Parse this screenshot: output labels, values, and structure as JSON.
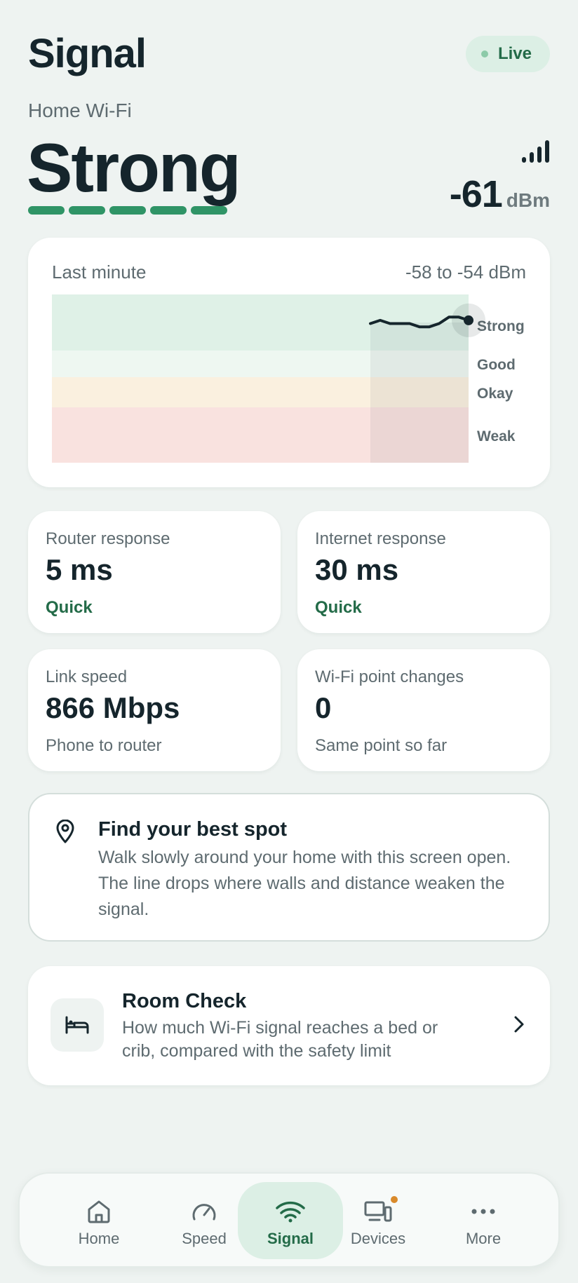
{
  "header": {
    "title": "Signal",
    "live_label": "Live"
  },
  "signal": {
    "network": "Home Wi-Fi",
    "strength": "Strong",
    "level_bars": 5,
    "dbm_value": "-61",
    "dbm_unit": "dBm"
  },
  "chart": {
    "label": "Last minute",
    "range": "-58 to -54 dBm",
    "bands": [
      {
        "name": "Strong",
        "color": "#dff1e7"
      },
      {
        "name": "Good",
        "color": "#eef7f1"
      },
      {
        "name": "Okay",
        "color": "#faf0df"
      },
      {
        "name": "Weak",
        "color": "#f9e2df"
      }
    ]
  },
  "chart_data": {
    "type": "line",
    "x": [
      0,
      1,
      2,
      3,
      4,
      5,
      6,
      7,
      8,
      9,
      10
    ],
    "y": [
      -57,
      -56,
      -57,
      -57,
      -57,
      -58,
      -58,
      -57,
      -55,
      -55,
      -56
    ],
    "ylim": [
      -100,
      -48
    ]
  },
  "metrics": [
    {
      "label": "Router response",
      "value": "5 ms",
      "sub": "Quick",
      "good": true
    },
    {
      "label": "Internet response",
      "value": "30 ms",
      "sub": "Quick",
      "good": true
    },
    {
      "label": "Link speed",
      "value": "866 Mbps",
      "sub": "Phone to router",
      "good": false
    },
    {
      "label": "Wi-Fi point changes",
      "value": "0",
      "sub": "Same point so far",
      "good": false
    }
  ],
  "tip": {
    "title": "Find your best spot",
    "text": "Walk slowly around your home with this screen open. The line drops where walls and distance weaken the signal."
  },
  "room_check": {
    "title": "Room Check",
    "text": "How much Wi-Fi signal reaches a bed or crib, compared with the safety limit"
  },
  "nav": {
    "items": [
      {
        "label": "Home",
        "icon": "home-icon"
      },
      {
        "label": "Speed",
        "icon": "speedometer-icon"
      },
      {
        "label": "Signal",
        "icon": "wifi-icon",
        "active": true
      },
      {
        "label": "Devices",
        "icon": "devices-icon",
        "badge": true
      },
      {
        "label": "More",
        "icon": "more-icon"
      }
    ]
  },
  "colors": {
    "accent": "#2f9466",
    "accent_dark": "#236b48",
    "badge": "#d98a2b"
  }
}
